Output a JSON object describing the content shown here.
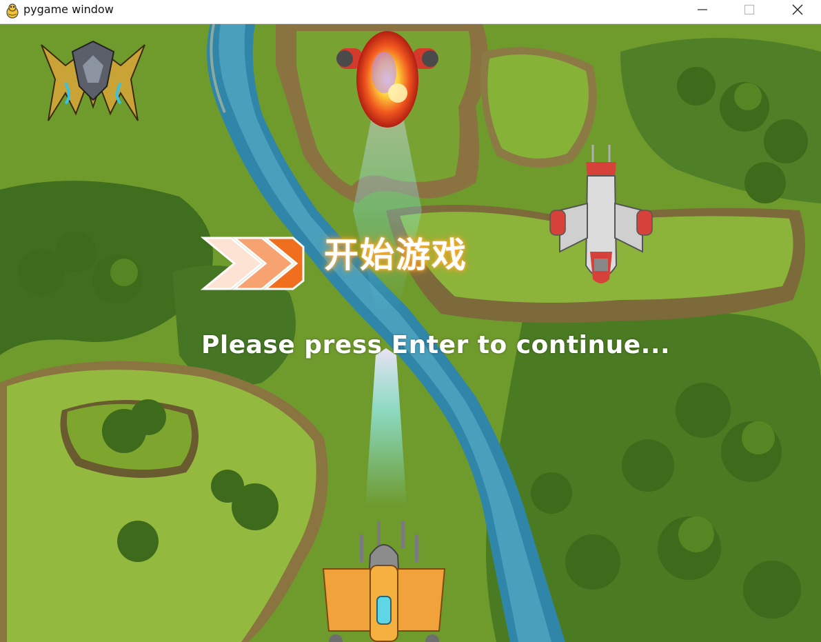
{
  "window": {
    "title": "pygame window",
    "icon": "pygame-snake-icon",
    "controls": {
      "minimize": "minimize-icon",
      "maximize": "maximize-icon",
      "close": "close-icon"
    }
  },
  "game": {
    "start_title": "开始游戏",
    "prompt": "Please press Enter to continue...",
    "sprites": {
      "boss": "boss-enemy-plane",
      "enemy_hit": "exploding-enemy-plane",
      "enemy": "red-enemy-plane",
      "player": "player-plane"
    },
    "colors": {
      "river": "#2f86a8",
      "grass": "#6f9a2c",
      "arrow_orange": "#f07a22",
      "title_glow": "#ffb13b"
    }
  }
}
